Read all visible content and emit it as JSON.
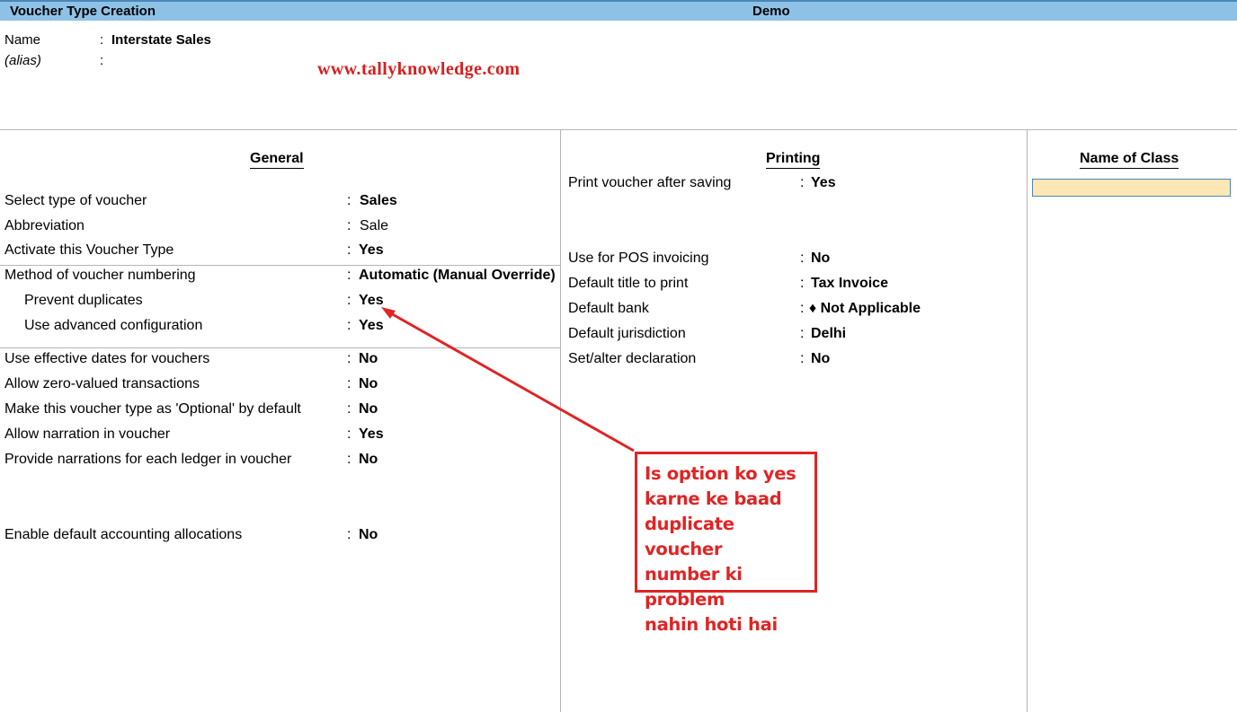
{
  "title_bar": {
    "screen_title": "Voucher Type Creation",
    "company": "Demo"
  },
  "header": {
    "name_label": "Name",
    "name_value": "Interstate Sales",
    "alias_label": "(alias)",
    "alias_value": "",
    "watermark": "www.tallyknowledge.com"
  },
  "general": {
    "title": "General",
    "rows": [
      {
        "label": "Select type of voucher",
        "value": "Sales"
      },
      {
        "label": "Abbreviation",
        "value": "Sale"
      },
      {
        "label": "Activate this Voucher Type",
        "value": "Yes"
      },
      {
        "label": "Method of voucher numbering",
        "value": "Automatic (Manual Override)"
      },
      {
        "label": "Prevent duplicates",
        "value": "Yes"
      },
      {
        "label": "Use advanced configuration",
        "value": "Yes"
      },
      {
        "label": "Use effective dates for vouchers",
        "value": "No"
      },
      {
        "label": "Allow zero-valued transactions",
        "value": "No"
      },
      {
        "label": "Make this voucher type as 'Optional' by default",
        "value": "No"
      },
      {
        "label": "Allow narration in voucher",
        "value": "Yes"
      },
      {
        "label": "Provide narrations for each ledger in voucher",
        "value": "No"
      },
      {
        "label": "Enable default accounting allocations",
        "value": "No"
      }
    ]
  },
  "printing": {
    "title": "Printing",
    "rows": [
      {
        "label": "Print voucher after saving",
        "value": "Yes"
      },
      {
        "label": "Use for POS invoicing",
        "value": "No"
      },
      {
        "label": "Default title to print",
        "value": "Tax Invoice"
      },
      {
        "label": "Default bank",
        "value": "♦ Not Applicable"
      },
      {
        "label": "Default jurisdiction",
        "value": "Delhi"
      },
      {
        "label": "Set/alter declaration",
        "value": "No"
      }
    ]
  },
  "class_panel": {
    "title": "Name of Class",
    "input_value": ""
  },
  "annotation": {
    "lines": [
      "Is option ko yes",
      "karne ke baad",
      "duplicate voucher",
      "number ki problem",
      "nahin hoti hai"
    ],
    "color": "#e02424"
  },
  "colors": {
    "title_bar": "#8ec1e6",
    "input_fill": "#fde7b5",
    "annotation": "#e02424"
  }
}
